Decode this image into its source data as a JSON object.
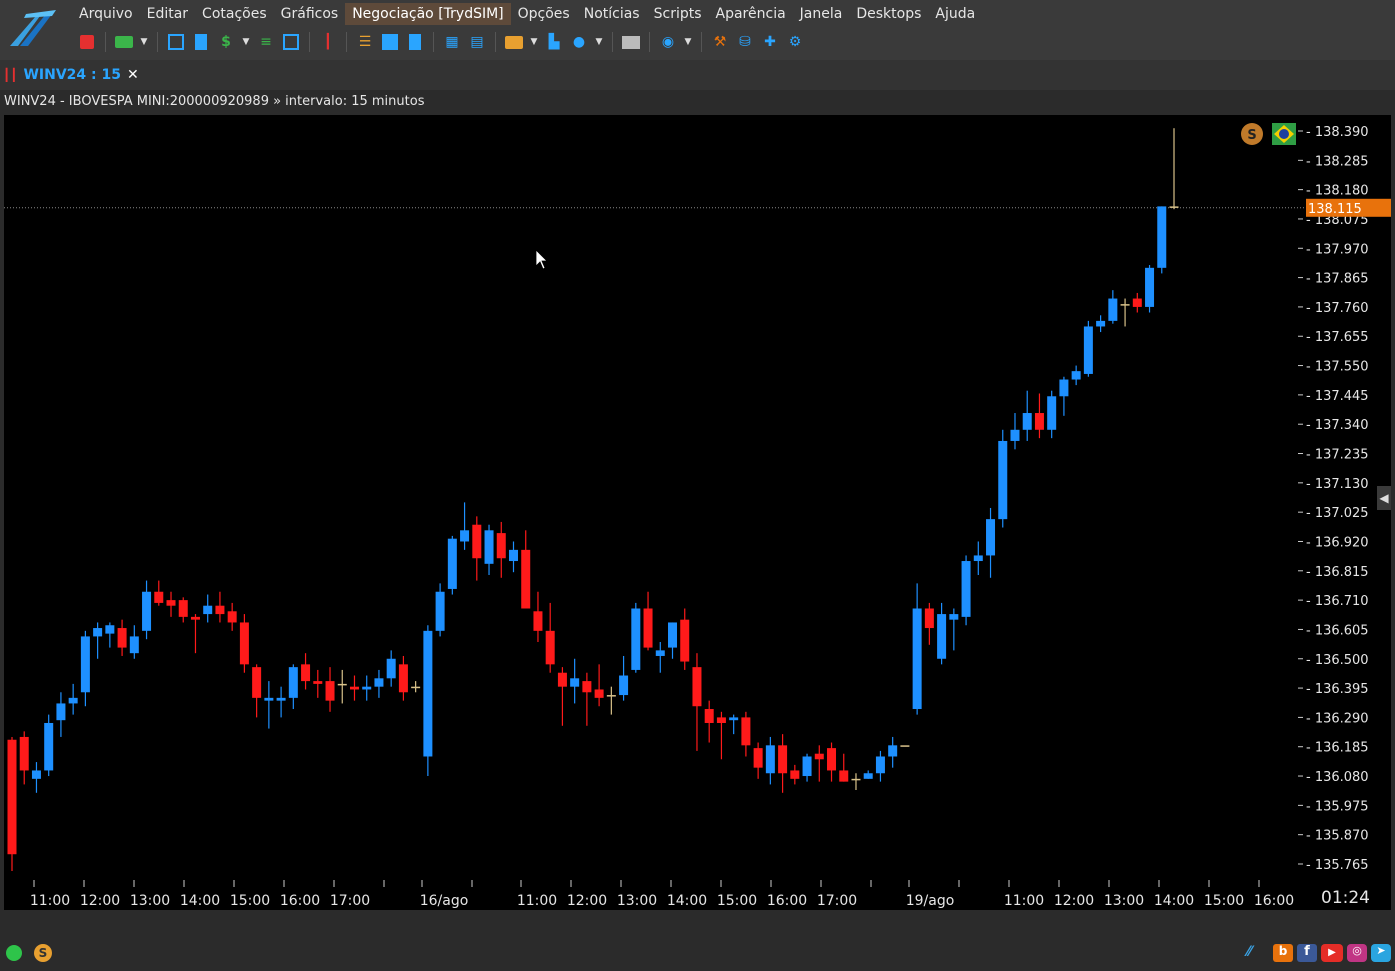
{
  "menu": {
    "items": [
      "Arquivo",
      "Editar",
      "Cotações",
      "Gráficos",
      "Negociação [TrydSIM]",
      "Opções",
      "Notícias",
      "Scripts",
      "Aparência",
      "Janela",
      "Desktops",
      "Ajuda"
    ],
    "active_index": 4
  },
  "tab": {
    "label": "WINV24 : 15",
    "close": "✕"
  },
  "info": {
    "text": "WINV24 - IBOVESPA MINI:200000920989 » intervalo: 15 minutos"
  },
  "colors": {
    "up": "#1e90ff",
    "down": "#ff1a1a",
    "doji": "#d9c28a",
    "price_tag": "#e8720c",
    "background": "#000000"
  },
  "chart_data": {
    "type": "candlestick",
    "title": "",
    "ylim": [
      135.7,
      138.45
    ],
    "y_ticks": [
      "138.390",
      "138.285",
      "138.180",
      "138.075",
      "137.970",
      "137.865",
      "137.760",
      "137.655",
      "137.550",
      "137.445",
      "137.340",
      "137.235",
      "137.130",
      "137.025",
      "136.920",
      "136.815",
      "136.710",
      "136.605",
      "136.500",
      "136.395",
      "136.290",
      "136.185",
      "136.080",
      "135.975",
      "135.870",
      "135.765"
    ],
    "x_ticks": [
      "11:00",
      "12:00",
      "13:00",
      "14:00",
      "15:00",
      "16:00",
      "17:00",
      "16/ago",
      "11:00",
      "12:00",
      "13:00",
      "14:00",
      "15:00",
      "16:00",
      "17:00",
      "19/ago",
      "11:00",
      "12:00",
      "13:00",
      "14:00",
      "15:00",
      "16:00"
    ],
    "last_price": "138.115",
    "countdown": "01:24",
    "candles": [
      {
        "o": 136.21,
        "h": 136.22,
        "l": 135.74,
        "c": 135.8
      },
      {
        "o": 136.22,
        "h": 136.24,
        "l": 136.05,
        "c": 136.1
      },
      {
        "o": 136.07,
        "h": 136.13,
        "l": 136.02,
        "c": 136.1
      },
      {
        "o": 136.1,
        "h": 136.3,
        "l": 136.08,
        "c": 136.27
      },
      {
        "o": 136.28,
        "h": 136.38,
        "l": 136.22,
        "c": 136.34
      },
      {
        "o": 136.34,
        "h": 136.41,
        "l": 136.3,
        "c": 136.36
      },
      {
        "o": 136.38,
        "h": 136.6,
        "l": 136.33,
        "c": 136.58
      },
      {
        "o": 136.58,
        "h": 136.63,
        "l": 136.5,
        "c": 136.61
      },
      {
        "o": 136.59,
        "h": 136.63,
        "l": 136.54,
        "c": 136.62
      },
      {
        "o": 136.61,
        "h": 136.64,
        "l": 136.51,
        "c": 136.54
      },
      {
        "o": 136.52,
        "h": 136.62,
        "l": 136.5,
        "c": 136.58
      },
      {
        "o": 136.6,
        "h": 136.78,
        "l": 136.57,
        "c": 136.74
      },
      {
        "o": 136.74,
        "h": 136.78,
        "l": 136.69,
        "c": 136.7
      },
      {
        "o": 136.71,
        "h": 136.74,
        "l": 136.65,
        "c": 136.69
      },
      {
        "o": 136.71,
        "h": 136.72,
        "l": 136.63,
        "c": 136.65
      },
      {
        "o": 136.65,
        "h": 136.66,
        "l": 136.52,
        "c": 136.64
      },
      {
        "o": 136.66,
        "h": 136.73,
        "l": 136.63,
        "c": 136.69
      },
      {
        "o": 136.69,
        "h": 136.74,
        "l": 136.63,
        "c": 136.66
      },
      {
        "o": 136.67,
        "h": 136.7,
        "l": 136.6,
        "c": 136.63
      },
      {
        "o": 136.63,
        "h": 136.66,
        "l": 136.45,
        "c": 136.48
      },
      {
        "o": 136.47,
        "h": 136.48,
        "l": 136.29,
        "c": 136.36
      },
      {
        "o": 136.35,
        "h": 136.42,
        "l": 136.25,
        "c": 136.36
      },
      {
        "o": 136.35,
        "h": 136.4,
        "l": 136.29,
        "c": 136.36
      },
      {
        "o": 136.36,
        "h": 136.48,
        "l": 136.32,
        "c": 136.47
      },
      {
        "o": 136.48,
        "h": 136.52,
        "l": 136.39,
        "c": 136.42
      },
      {
        "o": 136.42,
        "h": 136.46,
        "l": 136.36,
        "c": 136.41
      },
      {
        "o": 136.42,
        "h": 136.47,
        "l": 136.31,
        "c": 136.35
      },
      {
        "o": 136.41,
        "h": 136.46,
        "l": 136.34,
        "c": 136.41
      },
      {
        "o": 136.4,
        "h": 136.44,
        "l": 136.35,
        "c": 136.39
      },
      {
        "o": 136.39,
        "h": 136.44,
        "l": 136.35,
        "c": 136.4
      },
      {
        "o": 136.4,
        "h": 136.46,
        "l": 136.36,
        "c": 136.43
      },
      {
        "o": 136.43,
        "h": 136.53,
        "l": 136.4,
        "c": 136.5
      },
      {
        "o": 136.48,
        "h": 136.51,
        "l": 136.35,
        "c": 136.38
      },
      {
        "o": 136.4,
        "h": 136.42,
        "l": 136.38,
        "c": 136.4
      },
      {
        "o": 136.15,
        "h": 136.62,
        "l": 136.08,
        "c": 136.6
      },
      {
        "o": 136.6,
        "h": 136.77,
        "l": 136.58,
        "c": 136.74
      },
      {
        "o": 136.75,
        "h": 136.94,
        "l": 136.73,
        "c": 136.93
      },
      {
        "o": 136.92,
        "h": 137.06,
        "l": 136.89,
        "c": 136.96
      },
      {
        "o": 136.98,
        "h": 137.01,
        "l": 136.78,
        "c": 136.86
      },
      {
        "o": 136.84,
        "h": 136.98,
        "l": 136.8,
        "c": 136.96
      },
      {
        "o": 136.95,
        "h": 136.99,
        "l": 136.79,
        "c": 136.86
      },
      {
        "o": 136.85,
        "h": 136.92,
        "l": 136.81,
        "c": 136.89
      },
      {
        "o": 136.89,
        "h": 136.96,
        "l": 136.68,
        "c": 136.68
      },
      {
        "o": 136.67,
        "h": 136.74,
        "l": 136.56,
        "c": 136.6
      },
      {
        "o": 136.6,
        "h": 136.7,
        "l": 136.45,
        "c": 136.48
      },
      {
        "o": 136.45,
        "h": 136.47,
        "l": 136.26,
        "c": 136.4
      },
      {
        "o": 136.4,
        "h": 136.5,
        "l": 136.34,
        "c": 136.43
      },
      {
        "o": 136.42,
        "h": 136.45,
        "l": 136.26,
        "c": 136.38
      },
      {
        "o": 136.39,
        "h": 136.48,
        "l": 136.33,
        "c": 136.36
      },
      {
        "o": 136.37,
        "h": 136.4,
        "l": 136.3,
        "c": 136.37
      },
      {
        "o": 136.37,
        "h": 136.51,
        "l": 136.35,
        "c": 136.44
      },
      {
        "o": 136.46,
        "h": 136.7,
        "l": 136.45,
        "c": 136.68
      },
      {
        "o": 136.68,
        "h": 136.74,
        "l": 136.53,
        "c": 136.54
      },
      {
        "o": 136.51,
        "h": 136.56,
        "l": 136.45,
        "c": 136.53
      },
      {
        "o": 136.54,
        "h": 136.63,
        "l": 136.5,
        "c": 136.63
      },
      {
        "o": 136.64,
        "h": 136.68,
        "l": 136.46,
        "c": 136.49
      },
      {
        "o": 136.47,
        "h": 136.52,
        "l": 136.17,
        "c": 136.33
      },
      {
        "o": 136.32,
        "h": 136.35,
        "l": 136.2,
        "c": 136.27
      },
      {
        "o": 136.29,
        "h": 136.31,
        "l": 136.14,
        "c": 136.27
      },
      {
        "o": 136.28,
        "h": 136.3,
        "l": 136.23,
        "c": 136.29
      },
      {
        "o": 136.29,
        "h": 136.31,
        "l": 136.15,
        "c": 136.19
      },
      {
        "o": 136.18,
        "h": 136.2,
        "l": 136.07,
        "c": 136.11
      },
      {
        "o": 136.09,
        "h": 136.22,
        "l": 136.05,
        "c": 136.19
      },
      {
        "o": 136.19,
        "h": 136.23,
        "l": 136.02,
        "c": 136.09
      },
      {
        "o": 136.1,
        "h": 136.12,
        "l": 136.05,
        "c": 136.07
      },
      {
        "o": 136.08,
        "h": 136.16,
        "l": 136.06,
        "c": 136.15
      },
      {
        "o": 136.16,
        "h": 136.19,
        "l": 136.06,
        "c": 136.14
      },
      {
        "o": 136.18,
        "h": 136.2,
        "l": 136.06,
        "c": 136.1
      },
      {
        "o": 136.1,
        "h": 136.16,
        "l": 136.06,
        "c": 136.06
      },
      {
        "o": 136.07,
        "h": 136.09,
        "l": 136.03,
        "c": 136.07
      },
      {
        "o": 136.07,
        "h": 136.1,
        "l": 136.07,
        "c": 136.09
      },
      {
        "o": 136.09,
        "h": 136.17,
        "l": 136.06,
        "c": 136.15
      },
      {
        "o": 136.15,
        "h": 136.22,
        "l": 136.11,
        "c": 136.19
      },
      {
        "o": 136.19,
        "h": 136.19,
        "l": 136.19,
        "c": 136.19
      },
      {
        "o": 136.32,
        "h": 136.77,
        "l": 136.3,
        "c": 136.68
      },
      {
        "o": 136.68,
        "h": 136.7,
        "l": 136.55,
        "c": 136.61
      },
      {
        "o": 136.5,
        "h": 136.7,
        "l": 136.48,
        "c": 136.66
      },
      {
        "o": 136.64,
        "h": 136.68,
        "l": 136.53,
        "c": 136.66
      },
      {
        "o": 136.65,
        "h": 136.87,
        "l": 136.62,
        "c": 136.85
      },
      {
        "o": 136.85,
        "h": 136.92,
        "l": 136.8,
        "c": 136.87
      },
      {
        "o": 136.87,
        "h": 137.04,
        "l": 136.79,
        "c": 137.0
      },
      {
        "o": 137.0,
        "h": 137.32,
        "l": 136.97,
        "c": 137.28
      },
      {
        "o": 137.28,
        "h": 137.38,
        "l": 137.25,
        "c": 137.32
      },
      {
        "o": 137.32,
        "h": 137.46,
        "l": 137.28,
        "c": 137.38
      },
      {
        "o": 137.38,
        "h": 137.45,
        "l": 137.29,
        "c": 137.32
      },
      {
        "o": 137.32,
        "h": 137.46,
        "l": 137.29,
        "c": 137.44
      },
      {
        "o": 137.44,
        "h": 137.51,
        "l": 137.37,
        "c": 137.5
      },
      {
        "o": 137.5,
        "h": 137.55,
        "l": 137.48,
        "c": 137.53
      },
      {
        "o": 137.52,
        "h": 137.71,
        "l": 137.51,
        "c": 137.69
      },
      {
        "o": 137.69,
        "h": 137.73,
        "l": 137.67,
        "c": 137.71
      },
      {
        "o": 137.71,
        "h": 137.82,
        "l": 137.7,
        "c": 137.79
      },
      {
        "o": 137.77,
        "h": 137.79,
        "l": 137.69,
        "c": 137.77
      },
      {
        "o": 137.79,
        "h": 137.81,
        "l": 137.74,
        "c": 137.76
      },
      {
        "o": 137.76,
        "h": 137.91,
        "l": 137.74,
        "c": 137.9
      },
      {
        "o": 137.9,
        "h": 138.12,
        "l": 137.88,
        "c": 138.12
      },
      {
        "o": 138.12,
        "h": 138.4,
        "l": 138.11,
        "c": 138.12
      }
    ]
  },
  "status": {
    "s_badge": "S"
  }
}
